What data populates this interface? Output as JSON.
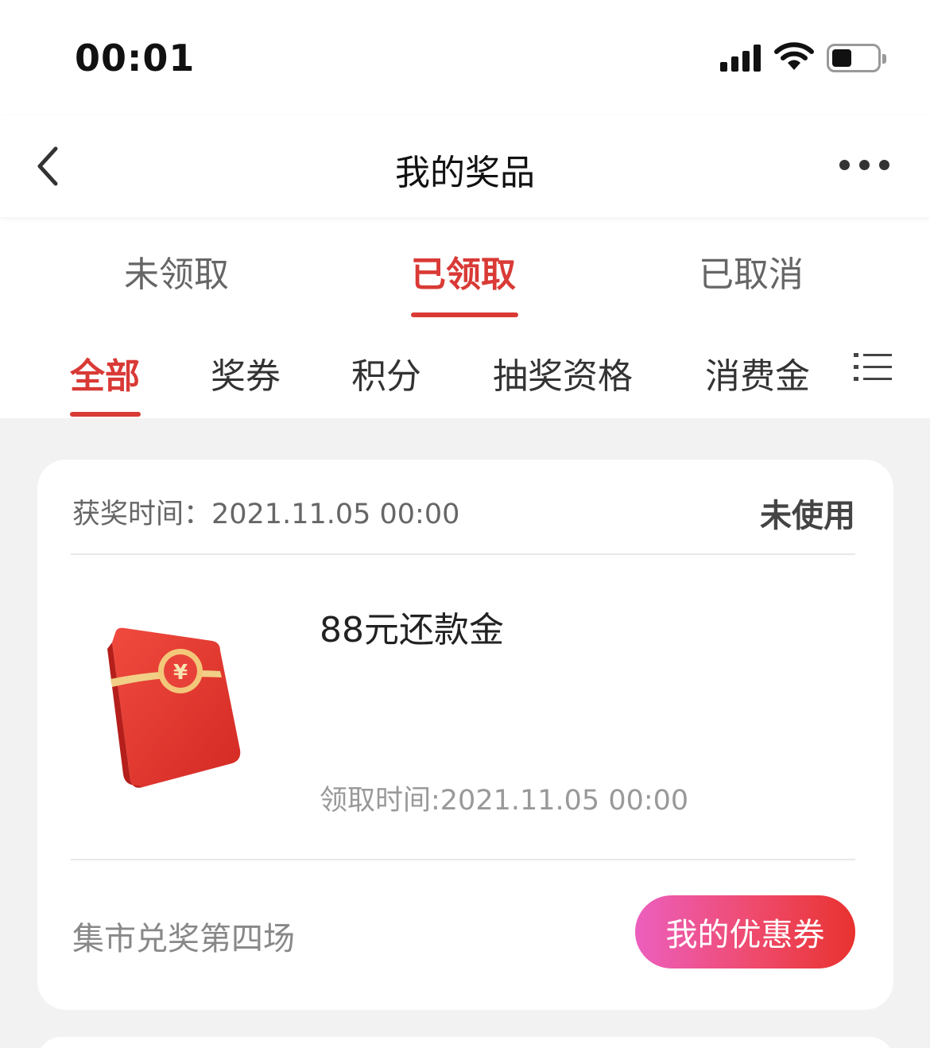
{
  "status_bar": {
    "time": "00:01",
    "icons": [
      "cellular-signal-icon",
      "wifi-icon",
      "battery-icon"
    ]
  },
  "nav": {
    "title": "我的奖品",
    "back_icon": "chevron-left-icon",
    "more_icon": "more-dots-icon"
  },
  "main_tabs": [
    {
      "label": "未领取",
      "active": false
    },
    {
      "label": "已领取",
      "active": true
    },
    {
      "label": "已取消",
      "active": false
    }
  ],
  "sub_tabs": [
    {
      "label": "全部",
      "active": true
    },
    {
      "label": "奖券",
      "active": false
    },
    {
      "label": "积分",
      "active": false
    },
    {
      "label": "抽奖资格",
      "active": false
    },
    {
      "label": "消费金",
      "active": false
    }
  ],
  "sub_tabs_menu_icon": "list-menu-icon",
  "prize": {
    "award_time": "获奖时间：2021.11.05 00:00",
    "status": "未使用",
    "name": "88元还款金",
    "image_icon": "red-envelope-icon",
    "receive_time": "领取时间:2021.11.05 00:00",
    "event": "集市兑奖第四场",
    "button_label": "我的优惠券"
  },
  "colors": {
    "accent": "#d93a36",
    "background": "#f2f2f2",
    "button_gradient": [
      "#ec5fbe",
      "#e8322e"
    ]
  }
}
